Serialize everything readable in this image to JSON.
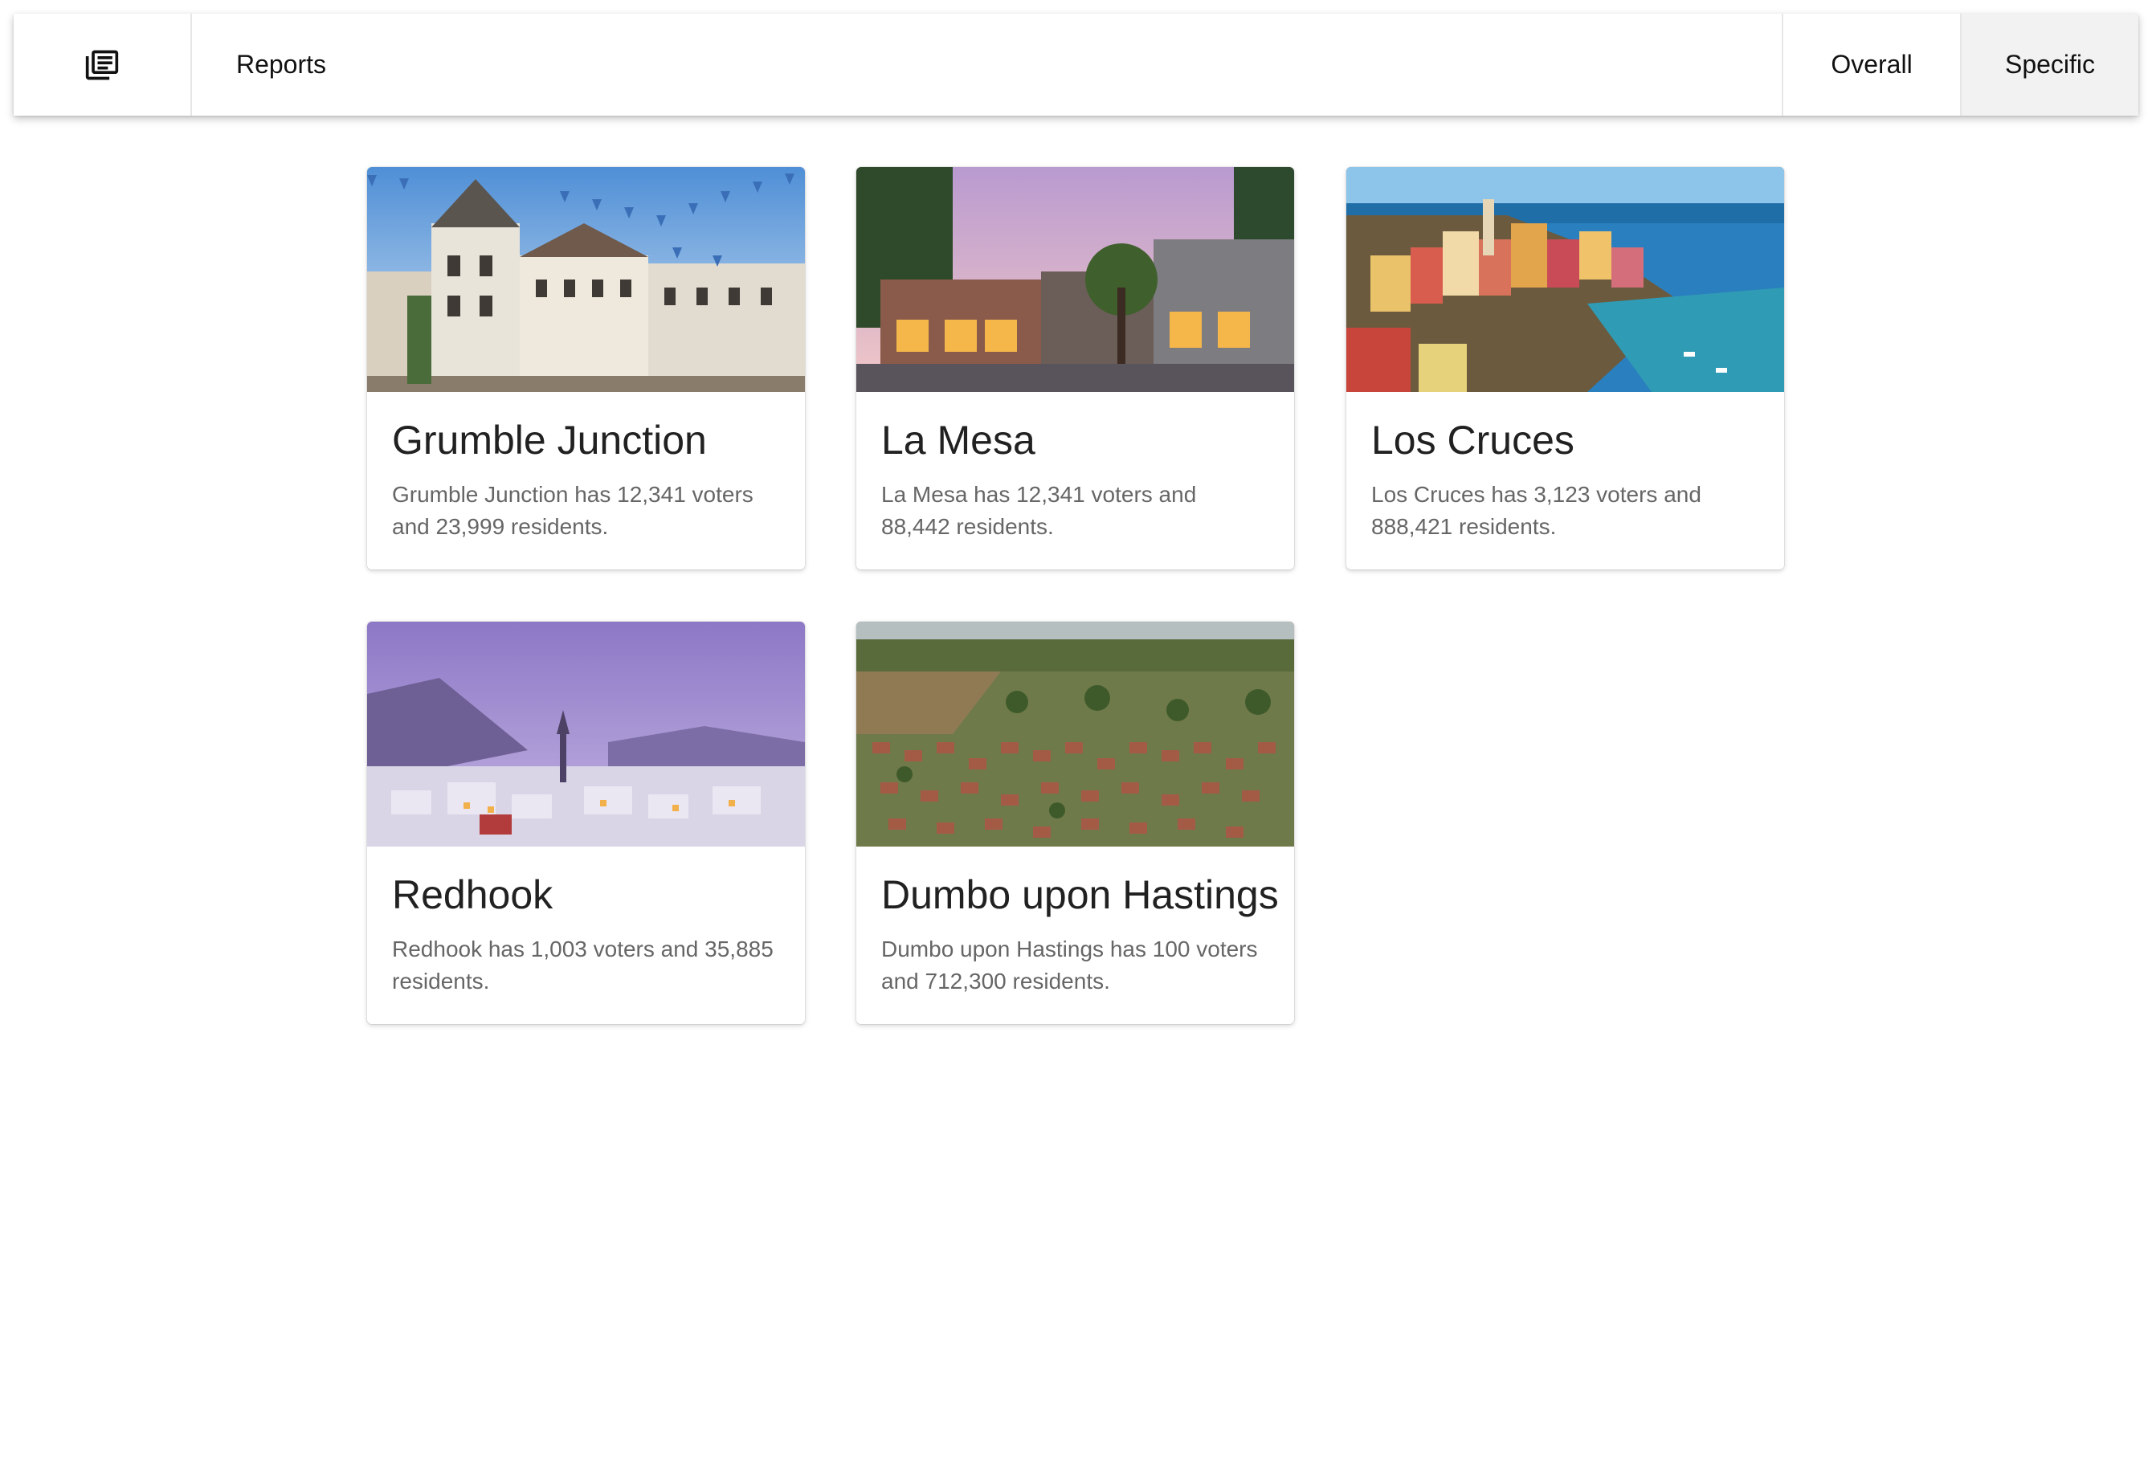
{
  "menu": {
    "logo_icon": "newspaper-icon",
    "reports_label": "Reports",
    "overall_label": "Overall",
    "specific_label": "Specific"
  },
  "cards": [
    {
      "title": "Grumble Junction",
      "description": "Grumble Junction has 12,341 voters and 23,999 residents.",
      "image_alt": "Bavarian town square with bunting flags"
    },
    {
      "title": "La Mesa",
      "description": "La Mesa has 12,341 voters and 88,442 residents.",
      "image_alt": "Small town main street at dusk"
    },
    {
      "title": "Los Cruces",
      "description": "Los Cruces has 3,123 voters and 888,421 residents.",
      "image_alt": "Colorful coastal village by the sea"
    },
    {
      "title": "Redhook",
      "description": "Redhook has 1,003 voters and 35,885 residents.",
      "image_alt": "Snowy village at twilight"
    },
    {
      "title": "Dumbo upon Hastings",
      "description": "Dumbo upon Hastings has 100 voters and 712,300 residents.",
      "image_alt": "Aerial view of suburban houses"
    }
  ],
  "colors": {
    "active_tab_bg": "#f2f2f2",
    "description_text": "#666666"
  }
}
